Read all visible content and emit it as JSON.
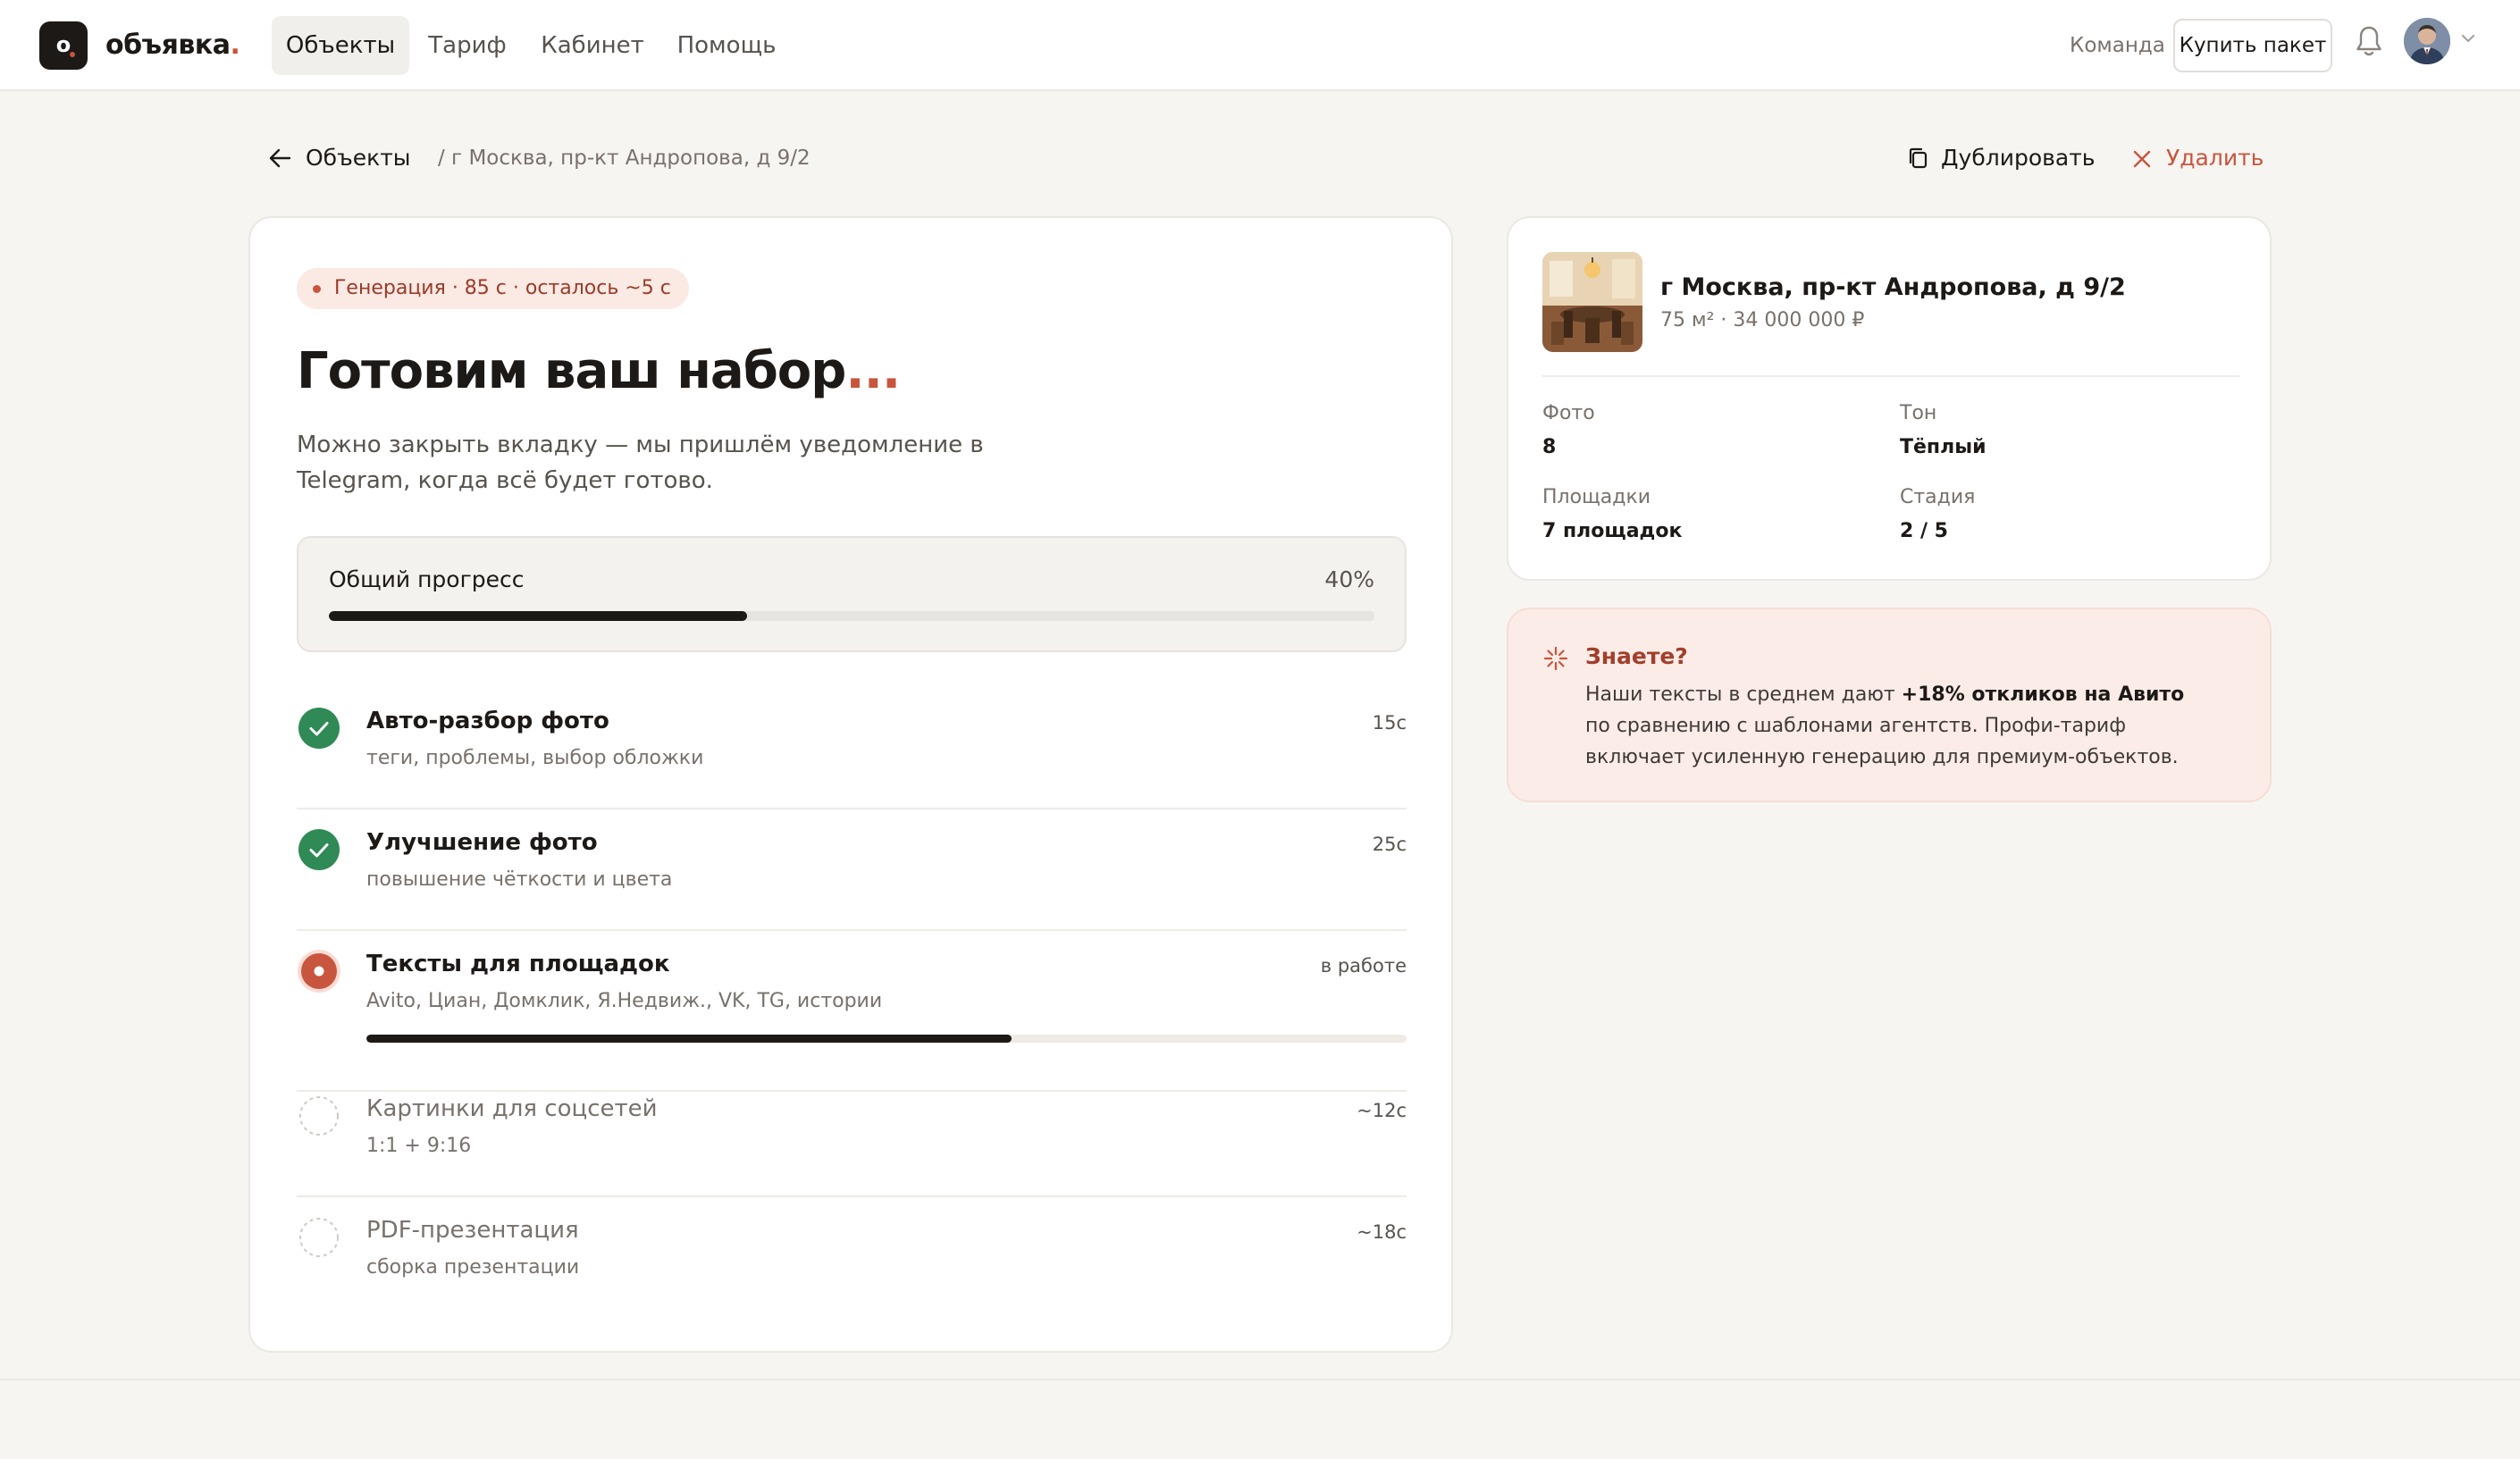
{
  "brand": {
    "logo_letter": "o",
    "name": "объявка",
    "name_dot": "."
  },
  "nav": [
    {
      "label": "Объекты",
      "active": true
    },
    {
      "label": "Тариф",
      "active": false
    },
    {
      "label": "Кабинет",
      "active": false
    },
    {
      "label": "Помощь",
      "active": false
    }
  ],
  "topbar": {
    "team_label": "Команда",
    "buy_label": "Купить пакет"
  },
  "breadcrumb": {
    "back_label": "Объекты",
    "path": "/ г Москва, пр-кт Андропова, д 9/2"
  },
  "actions": {
    "duplicate_label": "Дублировать",
    "delete_label": "Удалить"
  },
  "generation": {
    "status_pill": "Генерация · 85 с · осталось ~5 с",
    "title": "Готовим ваш набор",
    "title_ellipsis": "...",
    "description": "Можно закрыть вкладку — мы пришлём уведомление в Telegram, когда всё будет готово.",
    "overall": {
      "label": "Общий прогресс",
      "value_text": "40%",
      "value": 0.4
    },
    "steps": [
      {
        "title": "Авто-разбор фото",
        "subtitle": "теги, проблемы, выбор обложки",
        "time": "15с",
        "status": "done"
      },
      {
        "title": "Улучшение фото",
        "subtitle": "повышение чёткости и цвета",
        "time": "25с",
        "status": "done"
      },
      {
        "title": "Тексты для площадок",
        "subtitle": "Avito, Циан, Домклик, Я.Недвиж., VK, TG, истории",
        "time": "в работе",
        "status": "active",
        "progress": 0.62
      },
      {
        "title": "Картинки для соцсетей",
        "subtitle": "1:1 + 9:16",
        "time": "~12с",
        "status": "pending"
      },
      {
        "title": "PDF-презентация",
        "subtitle": "сборка презентации",
        "time": "~18с",
        "status": "pending"
      }
    ]
  },
  "summary": {
    "address": "г Москва, пр-кт Андропова, д 9/2",
    "meta": "75 м² · 34 000 000 ₽",
    "stats": [
      {
        "label": "Фото",
        "value": "8"
      },
      {
        "label": "Тон",
        "value": "Тёплый"
      },
      {
        "label": "Площадки",
        "value": "7 площадок"
      },
      {
        "label": "Стадия",
        "value": "2 / 5"
      }
    ]
  },
  "tip": {
    "title": "Знаете?",
    "body_before": "Наши тексты в среднем дают ",
    "body_bold": "+18% откликов на Авито",
    "body_after": " по сравнению с шаблонами агентств. Профи-тариф включает усиленную генерацию для премиум-объектов."
  },
  "icons": {
    "logo": "logo-mark",
    "bell": "bell-icon",
    "avatar": "user-avatar",
    "back": "arrow-left-icon",
    "duplicate": "copy-icon",
    "delete": "close-icon",
    "done": "check-circle-icon",
    "active": "active-dot-icon",
    "pending": "dashed-circle-icon",
    "tip": "sparkle-icon"
  },
  "colors": {
    "accent": "#c8553d",
    "success": "#2f8a55",
    "ink": "#1c1917",
    "muted": "#78716c",
    "background": "#f7f5f2",
    "tip_background": "#fcece7"
  }
}
